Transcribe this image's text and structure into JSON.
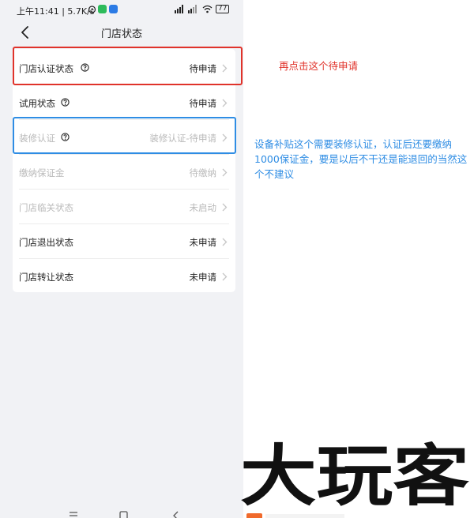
{
  "status_bar": {
    "time": "上午11:41 | 5.7K/s",
    "battery": "77"
  },
  "navbar": {
    "title": "门店状态"
  },
  "rows": [
    {
      "label": "门店认证状态",
      "status": "待申请",
      "has_help": true,
      "state": "active"
    },
    {
      "label": "试用状态",
      "status": "待申请",
      "has_help": true,
      "state": "active"
    },
    {
      "label": "装修认证",
      "status": "装修认证-待申请",
      "has_help": true,
      "state": "dim-label"
    },
    {
      "label": "缴纳保证金",
      "status": "待缴纳",
      "has_help": false,
      "state": "dim"
    },
    {
      "label": "门店临关状态",
      "status": "未启动",
      "has_help": false,
      "state": "dim"
    },
    {
      "label": "门店退出状态",
      "status": "未申请",
      "has_help": false,
      "state": "active"
    },
    {
      "label": "门店转让状态",
      "status": "未申请",
      "has_help": false,
      "state": "active"
    }
  ],
  "annotations": {
    "red_note": "再点击这个待申请",
    "blue_note": "设备补贴这个需要装修认证，认证后还要缴纳1000保证金，要是以后不干还是能退回的当然这个不建议",
    "red_color": "#e0332b",
    "blue_color": "#2f8de4"
  },
  "watermark": {
    "text": "大玩客"
  },
  "icons": {
    "back": "chevron-left-icon",
    "help": "question-circle-icon",
    "chevron": "chevron-right-icon"
  }
}
